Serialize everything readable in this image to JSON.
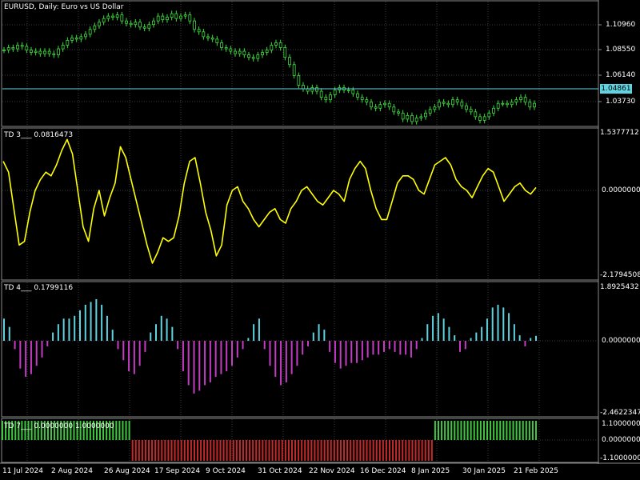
{
  "window": {
    "title": "EURUSD, Daily:  Euro vs US Dollar"
  },
  "colors": {
    "background": "#000000",
    "grid": "#3b3b3b",
    "price": "#3fdc3f",
    "bid_line": "#5fd3e0",
    "td3_line": "#ffff00",
    "td4_positive": "#5fd3e0",
    "td4_negative": "#c43cc4",
    "td7_positive": "#3fc83f",
    "td7_negative": "#c42a2a"
  },
  "price_pane": {
    "title": "EURUSD, Daily:  Euro vs US Dollar",
    "scale_labels": [
      "1.10960",
      "1.08550",
      "1.06140",
      "1.03730"
    ],
    "current_price": "1.04861",
    "series": [
      1.089,
      1.091,
      1.09,
      1.093,
      1.092,
      1.089,
      1.087,
      1.088,
      1.086,
      1.088,
      1.086,
      1.085,
      1.09,
      1.093,
      1.097,
      1.099,
      1.098,
      1.1,
      1.102,
      1.106,
      1.109,
      1.112,
      1.115,
      1.117,
      1.116,
      1.118,
      1.113,
      1.111,
      1.11,
      1.112,
      1.108,
      1.107,
      1.11,
      1.113,
      1.117,
      1.114,
      1.116,
      1.119,
      1.115,
      1.117,
      1.118,
      1.113,
      1.106,
      1.104,
      1.1,
      1.099,
      1.098,
      1.095,
      1.091,
      1.09,
      1.088,
      1.086,
      1.088,
      1.085,
      1.083,
      1.082,
      1.085,
      1.087,
      1.089,
      1.093,
      1.095,
      1.091,
      1.083,
      1.077,
      1.068,
      1.06,
      1.057,
      1.055,
      1.058,
      1.055,
      1.05,
      1.048,
      1.052,
      1.056,
      1.058,
      1.056,
      1.056,
      1.053,
      1.05,
      1.048,
      1.046,
      1.042,
      1.041,
      1.044,
      1.045,
      1.042,
      1.038,
      1.037,
      1.032,
      1.035,
      1.03,
      1.033,
      1.034,
      1.037,
      1.04,
      1.042,
      1.046,
      1.045,
      1.044,
      1.048,
      1.046,
      1.043,
      1.04,
      1.038,
      1.034,
      1.031,
      1.034,
      1.037,
      1.041,
      1.045,
      1.045,
      1.044,
      1.046,
      1.048,
      1.05,
      1.046,
      1.042,
      1.045
    ]
  },
  "td3": {
    "title": "TD 3___  0.0816473",
    "scale_top": "1.5377712",
    "scale_mid": "0.0000000",
    "scale_bottom": "-2.1794508",
    "series": [
      0.8,
      0.5,
      -0.5,
      -1.5,
      -1.4,
      -0.6,
      0.0,
      0.3,
      0.5,
      0.4,
      0.7,
      1.1,
      1.4,
      1.0,
      0.0,
      -1.0,
      -1.4,
      -0.5,
      0.0,
      -0.7,
      -0.2,
      0.2,
      1.2,
      0.9,
      0.3,
      -0.3,
      -0.9,
      -1.5,
      -2.0,
      -1.7,
      -1.3,
      -1.4,
      -1.3,
      -0.7,
      0.2,
      0.8,
      0.9,
      0.2,
      -0.6,
      -1.1,
      -1.8,
      -1.5,
      -0.4,
      0.0,
      0.1,
      -0.3,
      -0.5,
      -0.8,
      -1.0,
      -0.8,
      -0.6,
      -0.5,
      -0.8,
      -0.9,
      -0.5,
      -0.3,
      0.0,
      0.1,
      -0.1,
      -0.3,
      -0.4,
      -0.2,
      0.0,
      -0.1,
      -0.3,
      0.3,
      0.6,
      0.8,
      0.6,
      0.0,
      -0.5,
      -0.8,
      -0.8,
      -0.3,
      0.2,
      0.4,
      0.4,
      0.3,
      0.0,
      -0.1,
      0.3,
      0.7,
      0.8,
      0.9,
      0.7,
      0.3,
      0.1,
      0.0,
      -0.2,
      0.1,
      0.4,
      0.6,
      0.5,
      0.1,
      -0.3,
      -0.1,
      0.1,
      0.2,
      0.0,
      -0.1,
      0.08
    ]
  },
  "td4": {
    "title": "TD 4___  0.1799116",
    "scale_top": "1.8925432",
    "scale_mid": "0.0000000",
    "scale_bottom": "-2.4622347",
    "values": [
      0.8,
      0.5,
      -0.3,
      -1.0,
      -1.3,
      -1.2,
      -0.9,
      -0.6,
      -0.2,
      0.3,
      0.6,
      0.8,
      0.8,
      0.9,
      1.1,
      1.3,
      1.4,
      1.5,
      1.3,
      0.9,
      0.4,
      -0.3,
      -0.7,
      -1.1,
      -1.2,
      -0.9,
      -0.4,
      0.3,
      0.6,
      0.9,
      0.8,
      0.5,
      -0.3,
      -1.1,
      -1.6,
      -1.9,
      -1.8,
      -1.6,
      -1.5,
      -1.3,
      -1.2,
      -1.1,
      -0.9,
      -0.6,
      -0.3,
      0.1,
      0.6,
      0.8,
      -0.3,
      -0.9,
      -1.3,
      -1.6,
      -1.5,
      -1.2,
      -0.9,
      -0.5,
      -0.2,
      0.3,
      0.6,
      0.4,
      -0.4,
      -0.8,
      -1.0,
      -0.9,
      -0.8,
      -0.8,
      -0.7,
      -0.6,
      -0.5,
      -0.5,
      -0.4,
      -0.3,
      -0.4,
      -0.5,
      -0.5,
      -0.6,
      -0.3,
      0.1,
      0.6,
      0.9,
      1.0,
      0.8,
      0.5,
      0.2,
      -0.4,
      -0.3,
      0.1,
      0.3,
      0.5,
      0.8,
      1.2,
      1.3,
      1.2,
      1.0,
      0.6,
      0.2,
      -0.2,
      0.1,
      0.18
    ]
  },
  "td7": {
    "title": "TD 7___  0.0000000 1.0000000",
    "scale_top": "1.1000000",
    "scale_mid": "0.0000000",
    "scale_bottom": "-1.1000000",
    "values": [
      1,
      1,
      1,
      1,
      1,
      1,
      1,
      1,
      1,
      1,
      1,
      1,
      1,
      1,
      1,
      1,
      1,
      1,
      1,
      1,
      1,
      1,
      1,
      1,
      1,
      1,
      1,
      1,
      1,
      1,
      1,
      1,
      1,
      1,
      1,
      1,
      1,
      1,
      1,
      1,
      -1,
      -1,
      -1,
      -1,
      -1,
      -1,
      -1,
      -1,
      -1,
      -1,
      -1,
      -1,
      -1,
      -1,
      -1,
      -1,
      -1,
      -1,
      -1,
      -1,
      -1,
      -1,
      -1,
      -1,
      -1,
      -1,
      -1,
      -1,
      -1,
      -1,
      -1,
      -1,
      -1,
      -1,
      -1,
      -1,
      -1,
      -1,
      -1,
      -1,
      -1,
      -1,
      -1,
      -1,
      -1,
      -1,
      -1,
      -1,
      -1,
      -1,
      -1,
      -1,
      -1,
      -1,
      -1,
      -1,
      -1,
      -1,
      -1,
      -1,
      -1,
      -1,
      -1,
      -1,
      -1,
      -1,
      -1,
      -1,
      -1,
      -1,
      -1,
      -1,
      -1,
      -1,
      -1,
      -1,
      -1,
      -1,
      -1,
      -1,
      -1,
      -1,
      -1,
      -1,
      -1,
      -1,
      -1,
      -1,
      -1,
      -1,
      -1,
      -1,
      -1,
      1,
      1,
      1,
      1,
      1,
      1,
      1,
      1,
      1,
      1,
      1,
      1,
      1,
      1,
      1,
      1,
      1,
      1,
      1,
      1,
      1,
      1,
      1,
      1,
      1,
      1,
      1,
      1,
      1,
      1,
      1,
      1
    ]
  },
  "time_axis": [
    "11 Jul 2024",
    "2 Aug 2024",
    "26 Aug 2024",
    "17 Sep 2024",
    "9 Oct 2024",
    "31 Oct 2024",
    "22 Nov 2024",
    "16 Dec 2024",
    "8 Jan 2025",
    "30 Jan 2025",
    "21 Feb 2025"
  ]
}
